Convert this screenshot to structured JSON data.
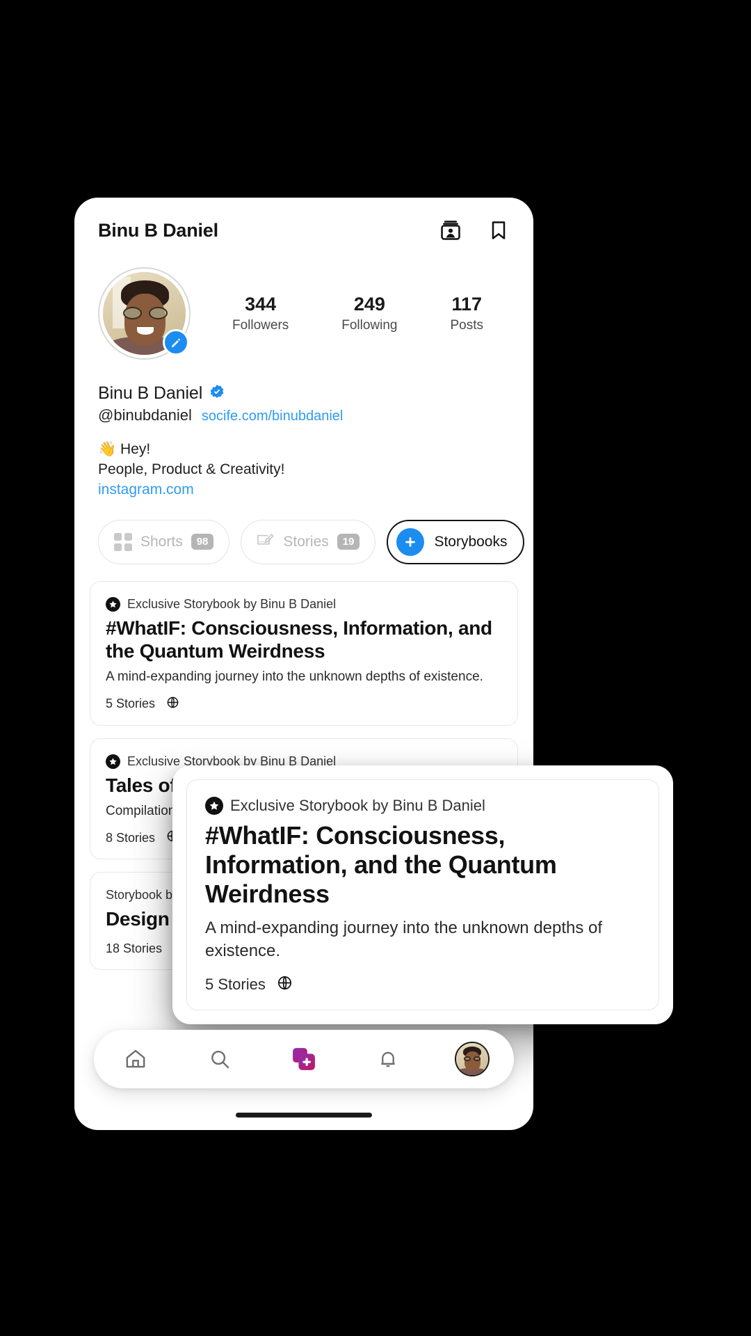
{
  "appbar": {
    "title": "Binu B Daniel",
    "contact_card_icon": "contact-card-icon",
    "bookmark_icon": "bookmark-icon"
  },
  "profile": {
    "avatar_alt": "Binu B Daniel profile photo",
    "edit_icon": "pencil-edit-icon",
    "stats": [
      {
        "value": "344",
        "label": "Followers"
      },
      {
        "value": "249",
        "label": "Following"
      },
      {
        "value": "117",
        "label": "Posts"
      }
    ],
    "display_name": "Binu B Daniel",
    "verified_icon": "verified-badge-icon",
    "handle": "@binubdaniel",
    "profile_url": "socife.com/binubdaniel",
    "bio_line_1": "👋  Hey!",
    "bio_line_2": "People, Product & Creativity!",
    "bio_link": "instagram.com"
  },
  "pills": [
    {
      "label": "Shorts",
      "count": "98",
      "icon": "grid-icon",
      "active": false
    },
    {
      "label": "Stories",
      "count": "19",
      "icon": "note-pen-icon",
      "active": false
    },
    {
      "label": "Storybooks",
      "count": "",
      "icon": "plus-circle-icon",
      "active": true
    }
  ],
  "storybooks": [
    {
      "kicker": "Exclusive Storybook by Binu B Daniel",
      "badge_icon": "star-badge-icon",
      "title": "#WhatIF: Consciousness, Information, and the Quantum Weirdness",
      "description": "A mind-expanding  journey into the unknown depths of existence.",
      "stories": "5 Stories",
      "visibility_icon": "globe-icon"
    },
    {
      "kicker": "Exclusive Storybook by Binu B Daniel",
      "badge_icon": "star-badge-icon",
      "title": "Tales of Entrepreneurial Experiences",
      "description": "Compilation of stories that illuminate the path of entrepreneurship.",
      "stories": "8 Stories",
      "visibility_icon": "globe-icon"
    },
    {
      "kicker": "Storybook by Binu B Daniel",
      "badge_icon": "",
      "title": "Design Notes",
      "description": "",
      "stories": "18 Stories",
      "visibility_icon": "globe-icon"
    }
  ],
  "floating_card": {
    "kicker": "Exclusive Storybook by Binu B Daniel",
    "badge_icon": "star-badge-icon",
    "title": "#WhatIF: Consciousness, Information, and the Quantum Weirdness",
    "description": "A mind-expanding  journey into the unknown depths of existence.",
    "stories": "5 Stories",
    "visibility_icon": "globe-icon"
  },
  "bottom_nav": [
    {
      "name": "home-icon",
      "label": "Home"
    },
    {
      "name": "search-icon",
      "label": "Search"
    },
    {
      "name": "create-icon",
      "label": "Create"
    },
    {
      "name": "bell-icon",
      "label": "Notifications"
    },
    {
      "name": "profile-avatar",
      "label": "Profile"
    }
  ],
  "colors": {
    "accent_blue": "#1c8cf0",
    "link_blue": "#2f9bf5",
    "background": "#000000",
    "surface": "#ffffff",
    "create_gradient_start": "#8e2fb8",
    "create_gradient_end": "#c2185b"
  }
}
